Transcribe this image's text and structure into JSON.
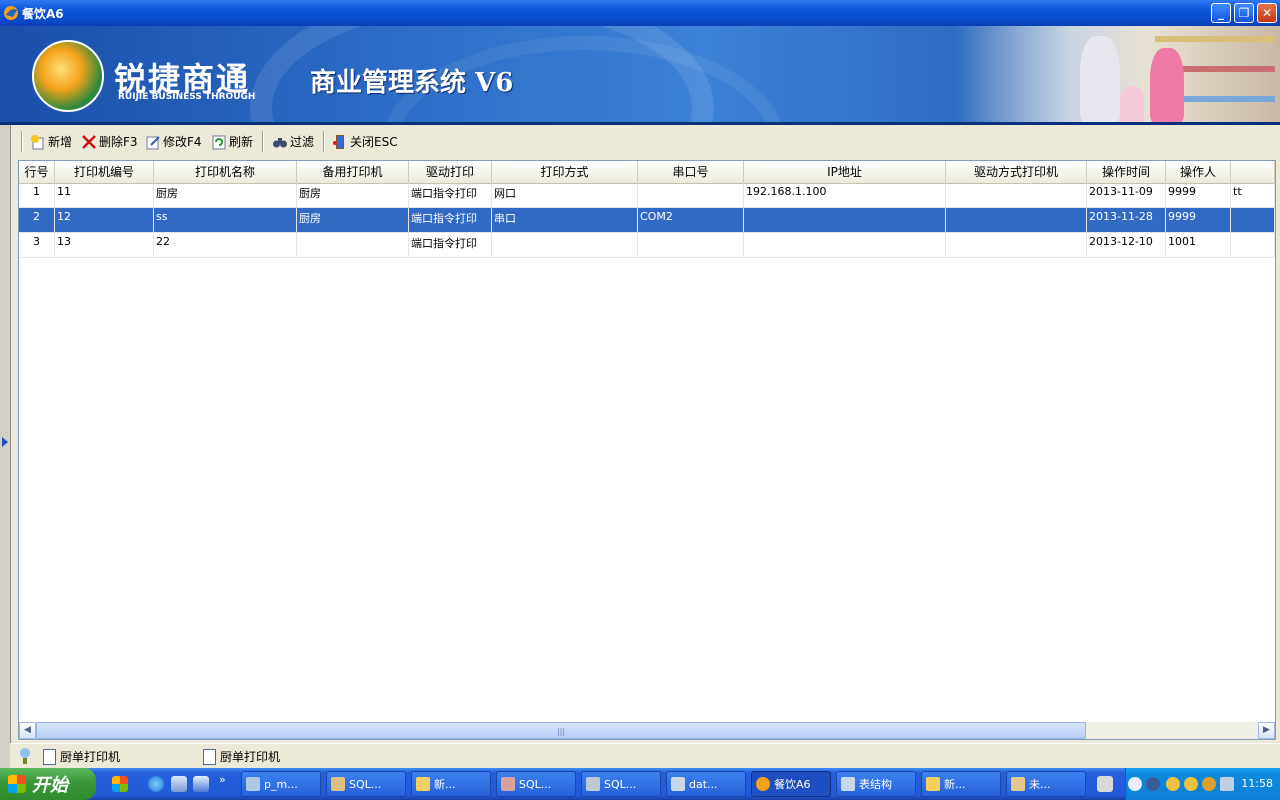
{
  "window": {
    "title": "餐饮A6",
    "minimize": "_",
    "restore": "❐",
    "close": "✕"
  },
  "banner": {
    "logo_text": "锐捷商通",
    "logo_sub": "RUIJIE BUSINESS THROUGH",
    "system_title": "商业管理系统 V6"
  },
  "toolbar": {
    "items": [
      {
        "label": "新增",
        "icon": "add-icon"
      },
      {
        "label": "删除F3",
        "icon": "delete-icon"
      },
      {
        "label": "修改F4",
        "icon": "edit-icon"
      },
      {
        "label": "刷新",
        "icon": "refresh-icon"
      },
      {
        "label": "过滤",
        "icon": "filter-icon"
      },
      {
        "label": "关闭ESC",
        "icon": "close-door-icon"
      }
    ]
  },
  "grid": {
    "columns": [
      "行号",
      "打印机编号",
      "打印机名称",
      "备用打印机",
      "驱动打印",
      "打印方式",
      "串口号",
      "IP地址",
      "驱动方式打印机",
      "操作时间",
      "操作人",
      ""
    ],
    "rows": [
      {
        "cells": [
          "1",
          "11",
          "厨房",
          "厨房",
          "端口指令打印",
          "网口",
          "",
          "192.168.1.100",
          "",
          "2013-11-09",
          "9999",
          "tt"
        ],
        "selected": false
      },
      {
        "cells": [
          "2",
          "12",
          "ss",
          "厨房",
          "端口指令打印",
          "串口",
          "COM2",
          "",
          "",
          "2013-11-28",
          "9999",
          ""
        ],
        "selected": true
      },
      {
        "cells": [
          "3",
          "13",
          "22",
          "",
          "端口指令打印",
          "",
          "",
          "",
          "",
          "2013-12-10",
          "1001",
          ""
        ],
        "selected": false
      }
    ],
    "selected_row_color": "#316ac5"
  },
  "statusbar": {
    "tabs": [
      "厨单打印机",
      "厨单打印机"
    ]
  },
  "taskbar": {
    "start_label": "开始",
    "more": "»",
    "tasks": [
      {
        "label": "p_m...",
        "active": false
      },
      {
        "label": "SQL...",
        "active": false
      },
      {
        "label": "新...",
        "active": false
      },
      {
        "label": "SQL...",
        "active": false
      },
      {
        "label": "SQL...",
        "active": false
      },
      {
        "label": "dat...",
        "active": false
      },
      {
        "label": "餐饮A6",
        "active": true
      },
      {
        "label": "表结构",
        "active": false
      },
      {
        "label": "新...",
        "active": false
      },
      {
        "label": "未...",
        "active": false
      }
    ],
    "clock": "11:58"
  }
}
